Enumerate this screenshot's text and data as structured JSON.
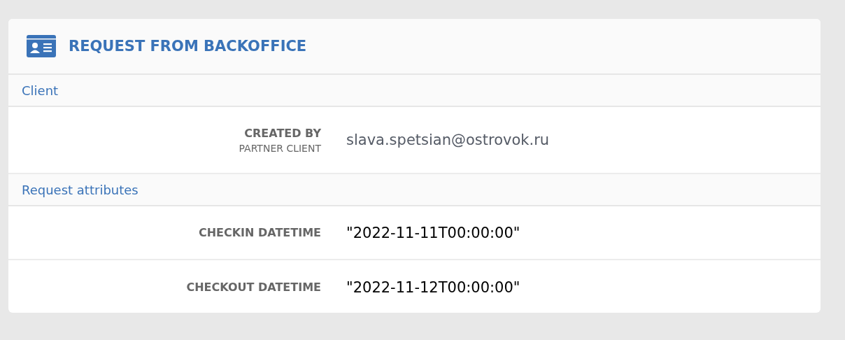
{
  "panel": {
    "title": "REQUEST FROM BACKOFFICE"
  },
  "sections": [
    {
      "title": "Client",
      "rows": [
        {
          "label": "CREATED BY",
          "sublabel": "PARTNER CLIENT",
          "value": "slava.spetsian@ostrovok.ru",
          "kind": "text"
        }
      ]
    },
    {
      "title": "Request attributes",
      "rows": [
        {
          "label": "CHECKIN DATETIME",
          "value": "\"2022-11-11T00:00:00\"",
          "kind": "json"
        },
        {
          "label": "CHECKOUT DATETIME",
          "value": "\"2022-11-12T00:00:00\"",
          "kind": "json"
        }
      ]
    }
  ]
}
